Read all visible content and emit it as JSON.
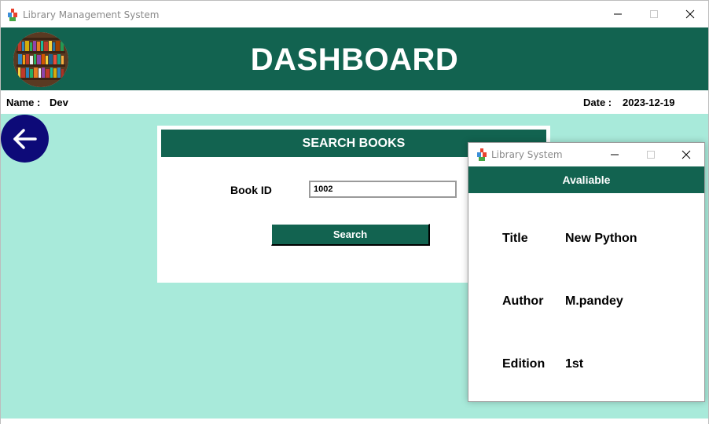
{
  "main_window": {
    "title": "Library Management System",
    "header_title": "DASHBOARD",
    "logo_icon": "bookshelf-logo",
    "user": {
      "label": "Name :",
      "value": "Dev"
    },
    "date": {
      "label": "Date :",
      "value": "2023-12-19"
    },
    "back_icon": "arrow-left-icon"
  },
  "search_panel": {
    "heading": "SEARCH BOOKS",
    "book_id_label": "Book ID",
    "book_id_value": "1002",
    "search_button": "Search"
  },
  "popup": {
    "title": "Library System",
    "status": "Avaliable",
    "fields": [
      {
        "label": "Title",
        "value": "New Python"
      },
      {
        "label": "Author",
        "value": "M.pandey"
      },
      {
        "label": "Edition",
        "value": "1st"
      }
    ]
  },
  "colors": {
    "header_green": "#126350",
    "background_mint": "#a8eada",
    "back_button_navy": "#0d0a78"
  }
}
